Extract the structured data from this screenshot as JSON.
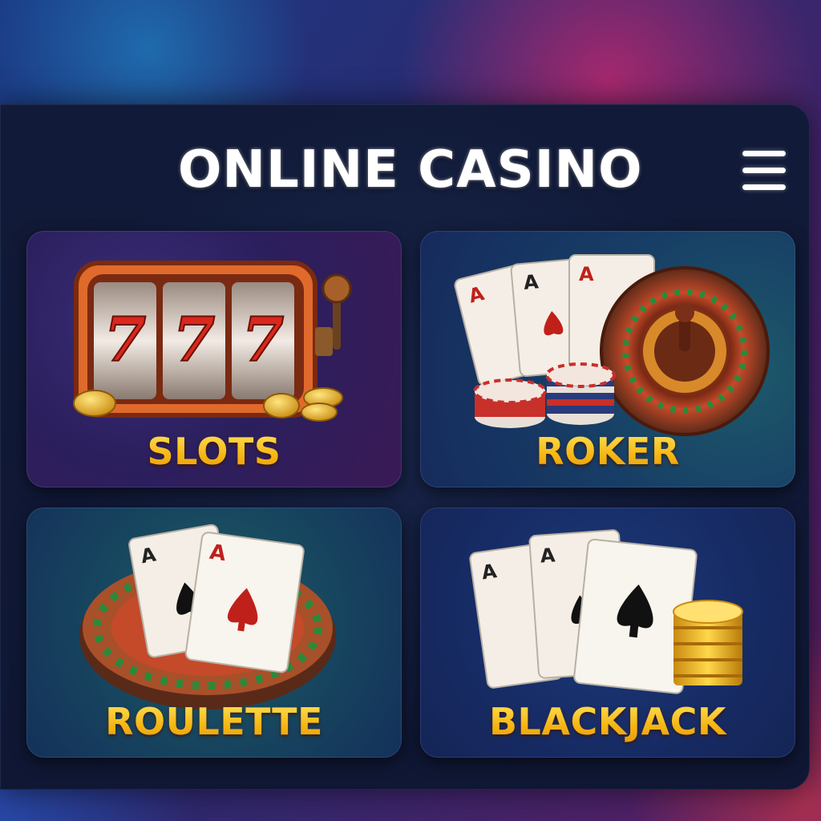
{
  "header": {
    "title": "ONLINE CASINO",
    "menu_icon": "hamburger-menu-icon"
  },
  "games": [
    {
      "label": "SLOTS",
      "icon": "slot-machine-icon"
    },
    {
      "label": "ROKER",
      "icon": "cards-roulette-chips-icon"
    },
    {
      "label": "ROULETTE",
      "icon": "roulette-cards-icon"
    },
    {
      "label": "BLACKJACK",
      "icon": "cards-coins-icon"
    }
  ],
  "slot_reels": [
    "7",
    "7",
    "7"
  ],
  "card_rank": "A",
  "colors": {
    "label_gold": "#f6c21c",
    "title_white": "#ffffff",
    "panel_navy": "#111a38"
  }
}
